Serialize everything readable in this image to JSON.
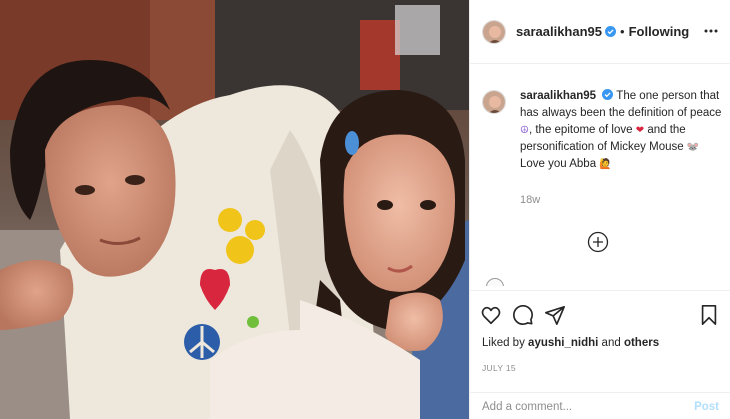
{
  "post": {
    "username": "saraalikhan95",
    "follow_status": "Following",
    "separator": "•",
    "caption": {
      "text_1": "The one person that has always been the definition of peace",
      "emoji_1": "☮",
      "text_2": ", the epitome of love",
      "emoji_2": "❤",
      "text_3": " and the personification of Mickey Mouse",
      "emoji_3": "🐭",
      "text_4": " Love you Abba",
      "emoji_4": "🙋"
    },
    "time_ago": "18w",
    "liked_by_prefix": "Liked by",
    "liked_by_user": "ayushi_nidhi",
    "liked_by_and": "and",
    "liked_by_others": "others",
    "date": "JULY 15"
  },
  "comment_box": {
    "placeholder": "Add a comment...",
    "post_label": "Post"
  },
  "icons": {
    "more": "more-options-icon",
    "verified": "verified-badge-icon",
    "load_more": "plus-circle-icon",
    "like": "heart-icon",
    "comment": "comment-icon",
    "share": "share-icon",
    "save": "bookmark-icon"
  },
  "colors": {
    "verified_blue": "#3897f0",
    "post_button": "#b2dffc",
    "secondary_text": "#8e8e8e",
    "heart_red": "#d7263d"
  }
}
